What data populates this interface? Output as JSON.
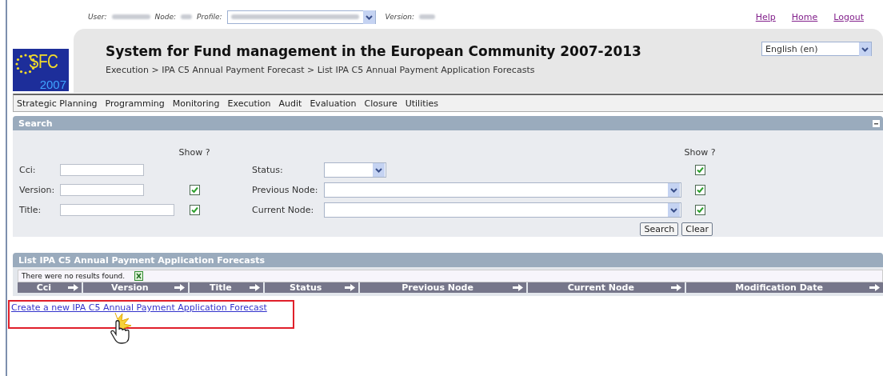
{
  "user_bar": {
    "user_label": "User:",
    "node_label": "Node:",
    "profile_label": "Profile:",
    "version_label": "Version:"
  },
  "top_links": [
    "Help",
    "Home",
    "Logout"
  ],
  "logo": {
    "text": "SFC",
    "year": "2007"
  },
  "header": {
    "title": "System for Fund management in the European Community 2007-2013",
    "breadcrumb": "Execution > IPA C5 Annual Payment Forecast > List IPA C5 Annual Payment Application Forecasts",
    "language": "English (en)"
  },
  "menu": [
    "Strategic Planning",
    "Programming",
    "Monitoring",
    "Execution",
    "Audit",
    "Evaluation",
    "Closure",
    "Utilities"
  ],
  "search": {
    "title": "Search",
    "show_heading_left": "Show ?",
    "show_heading_right": "Show ?",
    "left_fields": [
      {
        "label": "Cci:",
        "kind": "text"
      },
      {
        "label": "Version:",
        "kind": "text",
        "checked": true
      },
      {
        "label": "Title:",
        "kind": "text",
        "checked": true
      }
    ],
    "right_fields": [
      {
        "label": "Status:",
        "kind": "select",
        "checked": true
      },
      {
        "label": "Previous Node:",
        "kind": "select",
        "checked": true
      },
      {
        "label": "Current Node:",
        "kind": "select",
        "checked": true
      }
    ],
    "buttons": [
      "Search",
      "Clear"
    ]
  },
  "list": {
    "title": "List IPA C5 Annual Payment Application Forecasts",
    "message": "There were no results found.",
    "columns": [
      "Cci",
      "Version",
      "Title",
      "Status",
      "Previous Node",
      "Current Node",
      "Modification Date"
    ]
  },
  "create_link": "Create a new IPA C5 Annual Payment Application Forecast"
}
